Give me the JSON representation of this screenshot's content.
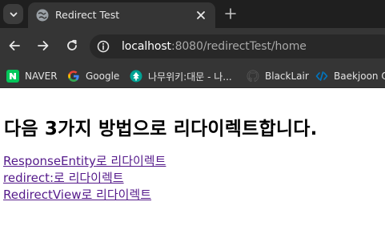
{
  "browser": {
    "tab": {
      "title": "Redirect Test"
    },
    "address": {
      "host": "localhost",
      "rest": ":8080/redirectTest/home"
    },
    "bookmarks": [
      {
        "label": "NAVER",
        "icon": "naver-icon",
        "color": "#03c75a",
        "glyph": "N"
      },
      {
        "label": "Google",
        "icon": "google-icon"
      },
      {
        "label": "나무위키:대문 - 나...",
        "icon": "namuwiki-icon",
        "color": "#00a495"
      },
      {
        "label": "BlackLair",
        "icon": "github-icon"
      },
      {
        "label": "Baekjoon O",
        "icon": "baekjoon-icon",
        "color": "#0076c0",
        "glyph": "/<>"
      }
    ]
  },
  "page": {
    "heading": "다음 3가지 방법으로 리다이렉트합니다.",
    "links": [
      {
        "label": "ResponseEntity로 리다이렉트"
      },
      {
        "label": "redirect:로 리다이렉트"
      },
      {
        "label": "RedirectView로 리다이렉트"
      }
    ]
  },
  "colors": {
    "chrome_dark": "#1f1f1f",
    "chrome_toolbar": "#353535",
    "visited_link": "#551a8b"
  }
}
